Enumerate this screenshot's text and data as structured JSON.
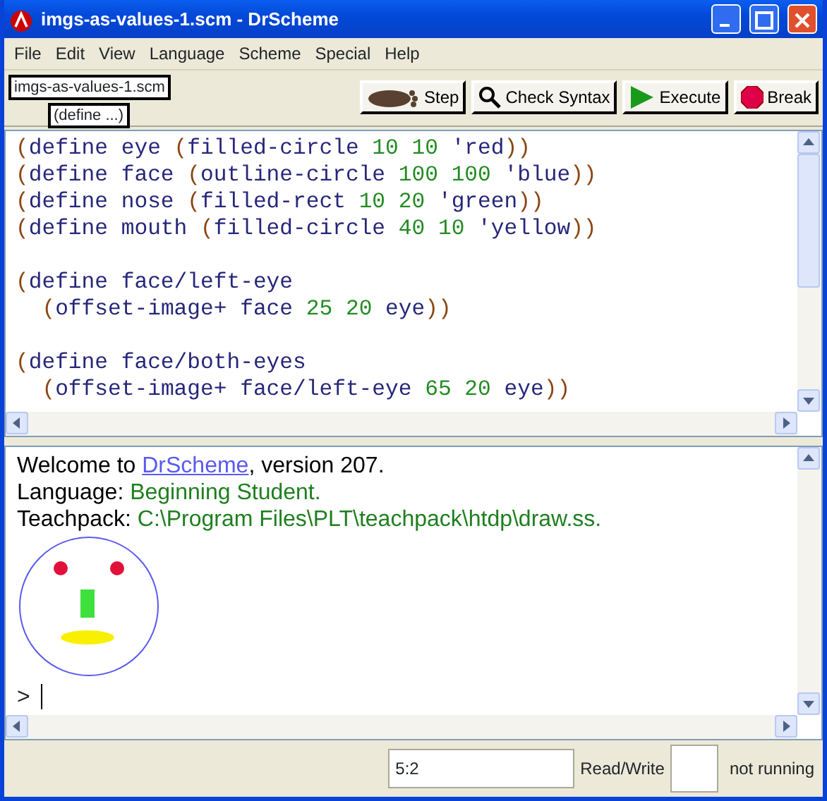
{
  "window": {
    "title": "imgs-as-values-1.scm - DrScheme"
  },
  "menu": [
    "File",
    "Edit",
    "View",
    "Language",
    "Scheme",
    "Special",
    "Help"
  ],
  "toolbar": {
    "file_name": "imgs-as-values-1.scm",
    "define_menu": "(define ...)",
    "buttons": [
      {
        "kind": "step",
        "label": "Step"
      },
      {
        "kind": "check",
        "label": "Check Syntax"
      },
      {
        "kind": "execute",
        "label": "Execute"
      },
      {
        "kind": "break",
        "label": "Break"
      }
    ]
  },
  "definitions": [
    {
      "lines": [
        [
          {
            "kind": "paren",
            "text": "("
          },
          {
            "kind": "id",
            "text": "define eye "
          },
          {
            "kind": "paren",
            "text": "("
          },
          {
            "kind": "id",
            "text": "filled-circle "
          },
          {
            "kind": "number",
            "text": "10 10 "
          },
          {
            "kind": "id",
            "text": "'red"
          },
          {
            "kind": "paren",
            "text": "))"
          }
        ],
        [
          {
            "kind": "paren",
            "text": "("
          },
          {
            "kind": "id",
            "text": "define face "
          },
          {
            "kind": "paren",
            "text": "("
          },
          {
            "kind": "id",
            "text": "outline-circle "
          },
          {
            "kind": "number",
            "text": "100 100 "
          },
          {
            "kind": "id",
            "text": "'blue"
          },
          {
            "kind": "paren",
            "text": "))"
          }
        ],
        [
          {
            "kind": "paren",
            "text": "("
          },
          {
            "kind": "id",
            "text": "define nose "
          },
          {
            "kind": "paren",
            "text": "("
          },
          {
            "kind": "id",
            "text": "filled-rect "
          },
          {
            "kind": "number",
            "text": "10 20 "
          },
          {
            "kind": "id",
            "text": "'green"
          },
          {
            "kind": "paren",
            "text": "))"
          }
        ],
        [
          {
            "kind": "paren",
            "text": "("
          },
          {
            "kind": "id",
            "text": "define mouth "
          },
          {
            "kind": "paren",
            "text": "("
          },
          {
            "kind": "id",
            "text": "filled-circle "
          },
          {
            "kind": "number",
            "text": "40 10 "
          },
          {
            "kind": "id",
            "text": "'yellow"
          },
          {
            "kind": "paren",
            "text": "))"
          }
        ]
      ]
    },
    {
      "lines": [
        [
          {
            "kind": "paren",
            "text": "("
          },
          {
            "kind": "id",
            "text": "define face/left-eye"
          }
        ],
        [
          {
            "kind": "paren",
            "text": "  ("
          },
          {
            "kind": "id",
            "text": "offset-image+ face "
          },
          {
            "kind": "number",
            "text": "25 20 "
          },
          {
            "kind": "id",
            "text": "eye"
          },
          {
            "kind": "paren",
            "text": "))"
          }
        ]
      ]
    },
    {
      "lines": [
        [
          {
            "kind": "paren",
            "text": "("
          },
          {
            "kind": "id",
            "text": "define face/both-eyes"
          }
        ],
        [
          {
            "kind": "paren",
            "text": "  ("
          },
          {
            "kind": "id",
            "text": "offset-image+ face/left-eye "
          },
          {
            "kind": "number",
            "text": "65 20 "
          },
          {
            "kind": "id",
            "text": "eye"
          },
          {
            "kind": "paren",
            "text": "))"
          }
        ]
      ]
    }
  ],
  "interactions": [
    [
      {
        "kind": "plain",
        "text": "Welcome to "
      },
      {
        "kind": "link",
        "text": "DrScheme"
      },
      {
        "kind": "plain",
        "text": ", version 207."
      }
    ],
    [
      {
        "kind": "plain",
        "text": "Language: "
      },
      {
        "kind": "value",
        "text": "Beginning Student."
      }
    ],
    [
      {
        "kind": "plain",
        "text": "Teachpack: "
      },
      {
        "kind": "value",
        "text": "C:\\Program Files\\PLT\\teachpack\\htdp\\draw.ss."
      }
    ]
  ],
  "prompt": ">",
  "status_bar": {
    "position": "5:2",
    "mode": "Read/Write",
    "state": "not running"
  }
}
